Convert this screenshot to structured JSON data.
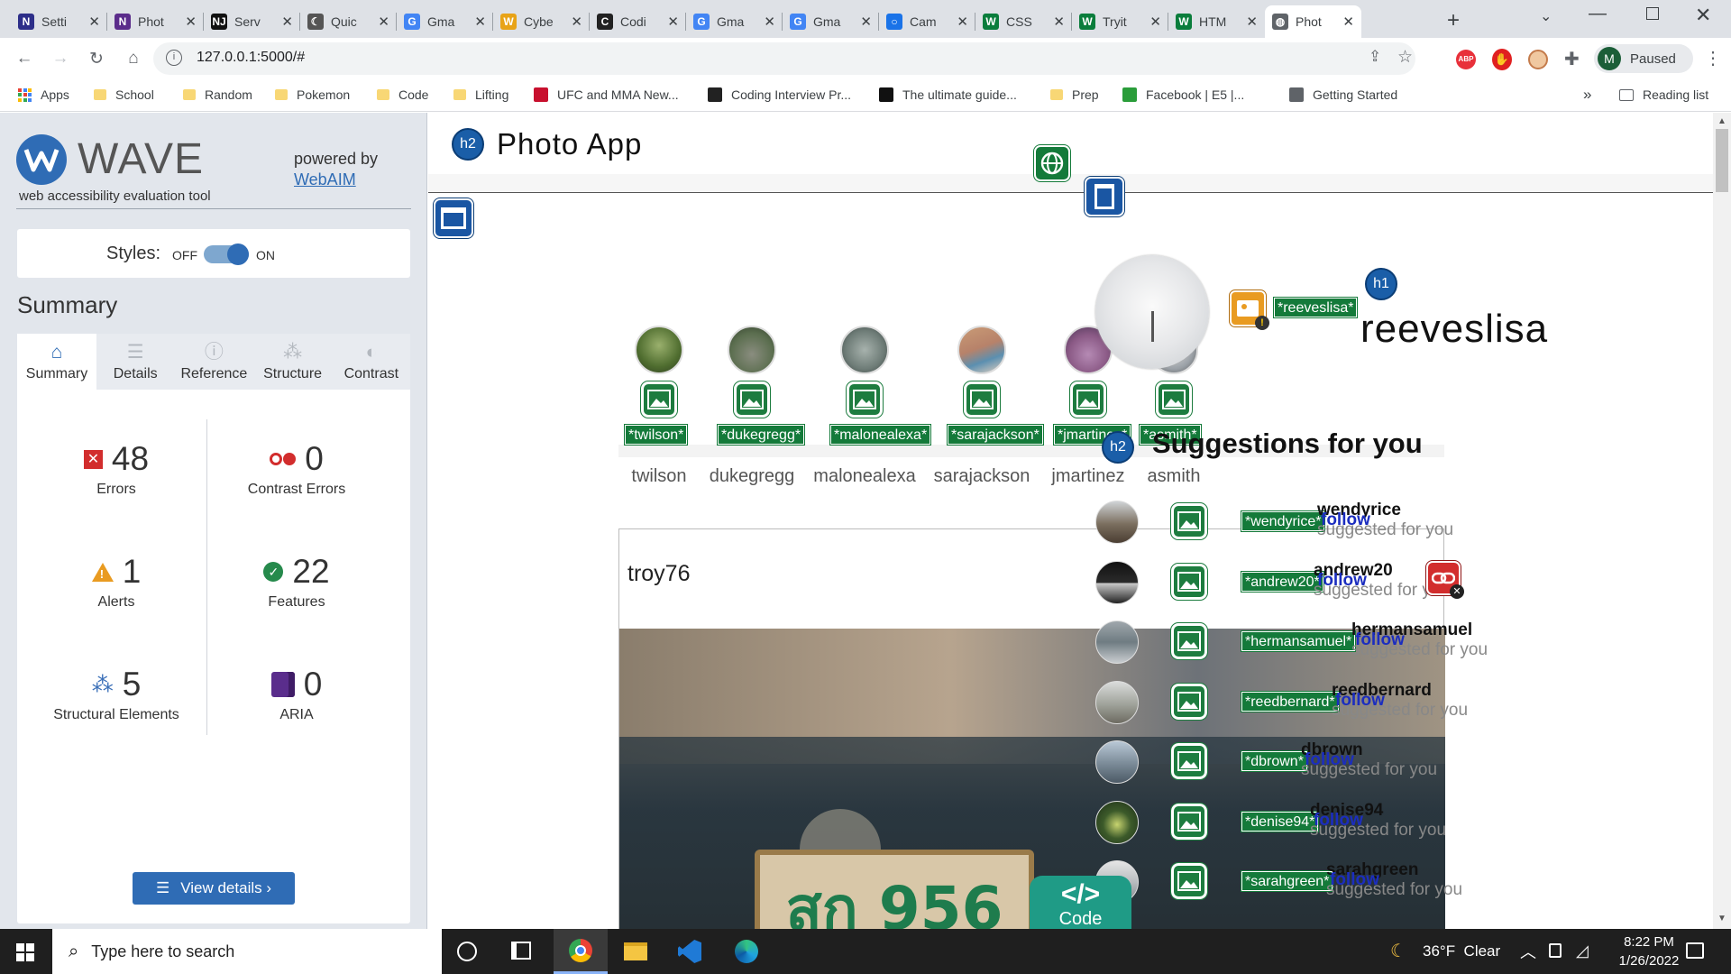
{
  "browser": {
    "tabs": [
      {
        "title": "Setti",
        "icon": "N",
        "color": "#2d2e89"
      },
      {
        "title": "Phot",
        "icon": "N",
        "color": "#5b2c8b"
      },
      {
        "title": "Serv",
        "icon": "NJ",
        "color": "#111111"
      },
      {
        "title": "Quic",
        "icon": "☾",
        "color": "#555555"
      },
      {
        "title": "Gma",
        "icon": "G",
        "color": "#4285f4"
      },
      {
        "title": "Cybe",
        "icon": "W",
        "color": "#e8a317"
      },
      {
        "title": "Codi",
        "icon": "C",
        "color": "#222222"
      },
      {
        "title": "Gma",
        "icon": "G",
        "color": "#4285f4"
      },
      {
        "title": "Gma",
        "icon": "G",
        "color": "#4285f4"
      },
      {
        "title": "Cam",
        "icon": "○",
        "color": "#1a73e8"
      },
      {
        "title": "CSS",
        "icon": "W",
        "color": "#0a7d3c"
      },
      {
        "title": "Tryit",
        "icon": "W",
        "color": "#0a7d3c"
      },
      {
        "title": "HTM",
        "icon": "W",
        "color": "#0a7d3c"
      },
      {
        "title": "Phot",
        "icon": "◍",
        "color": "#5f6368",
        "active": true
      }
    ],
    "url": "127.0.0.1:5000/#",
    "profile_initial": "M",
    "profile_status": "Paused",
    "bookmarks": [
      {
        "label": "Apps",
        "type": "apps"
      },
      {
        "label": "School",
        "type": "folder"
      },
      {
        "label": "Random",
        "type": "folder"
      },
      {
        "label": "Pokemon",
        "type": "folder"
      },
      {
        "label": "Code",
        "type": "folder"
      },
      {
        "label": "Lifting",
        "type": "folder"
      },
      {
        "label": "UFC and MMA New...",
        "type": "site",
        "color": "#c8102e"
      },
      {
        "label": "Coding Interview Pr...",
        "type": "site",
        "color": "#222222"
      },
      {
        "label": "The ultimate guide...",
        "type": "site",
        "color": "#111111"
      },
      {
        "label": "Prep",
        "type": "folder"
      },
      {
        "label": "Facebook | E5 |...",
        "type": "site",
        "color": "#2a9d3a"
      },
      {
        "label": "Getting Started",
        "type": "site",
        "color": "#5f6368"
      }
    ],
    "more_bookmarks": "»",
    "reading_list": "Reading list"
  },
  "wave": {
    "logo_text": "WAVE",
    "tagline": "web accessibility evaluation tool",
    "powered_by": "powered by",
    "powered_link": "WebAIM",
    "styles_label": "Styles:",
    "styles_off": "OFF",
    "styles_on": "ON",
    "summary_heading": "Summary",
    "tabs": [
      {
        "label": "Summary",
        "icon": "home-icon",
        "active": true
      },
      {
        "label": "Details",
        "icon": "list-icon"
      },
      {
        "label": "Reference",
        "icon": "info-icon"
      },
      {
        "label": "Structure",
        "icon": "sitemap-icon"
      },
      {
        "label": "Contrast",
        "icon": "contrast-icon"
      }
    ],
    "stats": {
      "errors": {
        "value": "48",
        "label": "Errors"
      },
      "contrast": {
        "value": "0",
        "label": "Contrast Errors"
      },
      "alerts": {
        "value": "1",
        "label": "Alerts"
      },
      "features": {
        "value": "22",
        "label": "Features"
      },
      "structure": {
        "value": "5",
        "label": "Structural Elements"
      },
      "aria": {
        "value": "0",
        "label": "ARIA"
      }
    },
    "view_details": "View details ›"
  },
  "photo_app": {
    "h2_badge": "h2",
    "title": "Photo App",
    "h1_badge": "h1",
    "profile_tag": "*reeveslisa*",
    "profile_username": "reeveslisa",
    "stories": [
      {
        "tag": "*twilson*",
        "name": "twilson"
      },
      {
        "tag": "*dukegregg*",
        "name": "dukegregg"
      },
      {
        "tag": "*malonealexa*",
        "name": "malonealexa"
      },
      {
        "tag": "*sarajackson*",
        "name": "sarajackson"
      },
      {
        "tag": "*jmartinez*",
        "name": "jmartinez"
      },
      {
        "tag": "*asmith*",
        "name": "asmith"
      }
    ],
    "post_author": "troy76",
    "plate_text": "สก 956",
    "suggestions_heading": "Suggestions for you",
    "suggestions": [
      {
        "tag": "*wendyrice*",
        "name": "wendyrice",
        "sub": "suggested for you",
        "follow": "follow"
      },
      {
        "tag": "*andrew20*",
        "name": "andrew20",
        "sub": "suggested for you",
        "follow": "follow"
      },
      {
        "tag": "*hermansamuel*",
        "name": "hermansamuel",
        "sub": "suggested for you",
        "follow": "follow"
      },
      {
        "tag": "*reedbernard*",
        "name": "reedbernard",
        "sub": "suggested for you",
        "follow": "follow"
      },
      {
        "tag": "*dbrown*",
        "name": "dbrown",
        "sub": "suggested for you",
        "follow": "follow"
      },
      {
        "tag": "*denise94*",
        "name": "denise94",
        "sub": "suggested for you",
        "follow": "follow"
      },
      {
        "tag": "*sarahgreen*",
        "name": "sarahgreen",
        "sub": "suggested for you",
        "follow": "follow"
      }
    ],
    "code_label": "Code",
    "code_glyph": "</>"
  },
  "taskbar": {
    "search_placeholder": "Type here to search",
    "weather": "36°F  Clear",
    "time": "8:22 PM",
    "date": "1/26/2022"
  }
}
